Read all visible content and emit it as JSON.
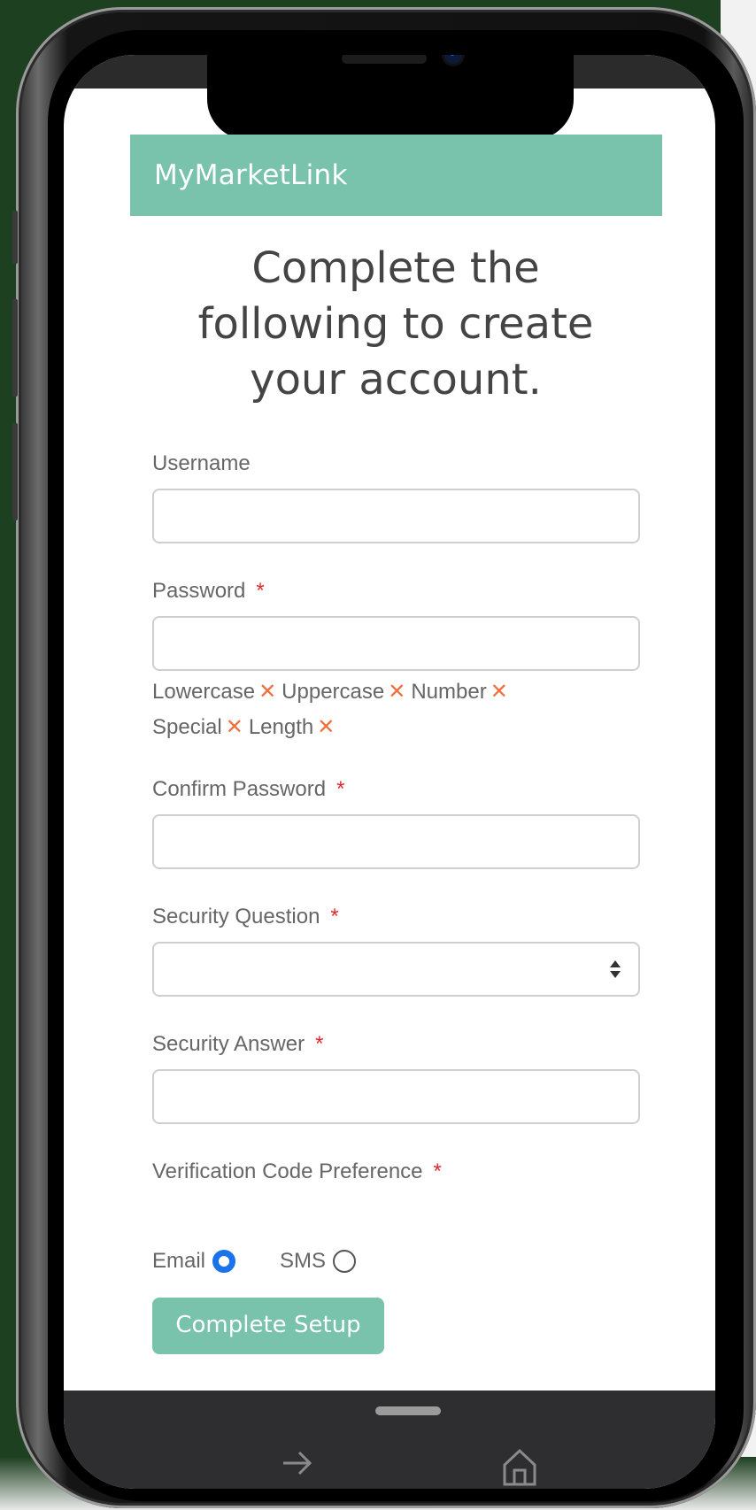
{
  "app": {
    "brand": "MyMarketLink"
  },
  "heading": {
    "line1": "Complete the",
    "line2": "following to create",
    "line3": "your account."
  },
  "form": {
    "username": {
      "label": "Username",
      "value": ""
    },
    "password": {
      "label": "Password",
      "required_mark": "*",
      "value": ""
    },
    "password_rules": [
      {
        "label": "Lowercase",
        "mark": "✕"
      },
      {
        "label": "Uppercase",
        "mark": "✕"
      },
      {
        "label": "Number",
        "mark": "✕"
      },
      {
        "label": "Special",
        "mark": "✕"
      },
      {
        "label": "Length",
        "mark": "✕"
      }
    ],
    "confirm_password": {
      "label": "Confirm Password",
      "required_mark": "*",
      "value": ""
    },
    "security_question": {
      "label": "Security Question",
      "required_mark": "*",
      "selected": ""
    },
    "security_answer": {
      "label": "Security Answer",
      "required_mark": "*",
      "value": ""
    },
    "verification": {
      "label": "Verification Code Preference",
      "required_mark": "*",
      "options": [
        {
          "label": "Email",
          "selected": true
        },
        {
          "label": "SMS",
          "selected": false
        }
      ]
    },
    "submit_label": "Complete Setup"
  },
  "navbar": {
    "back_icon": "arrow-right-icon",
    "home_icon": "home-icon"
  },
  "colors": {
    "accent": "#79c2ab",
    "required": "#e0282f",
    "invalid": "#f0713e",
    "radio": "#1a73e8",
    "background": "#1d4020"
  }
}
